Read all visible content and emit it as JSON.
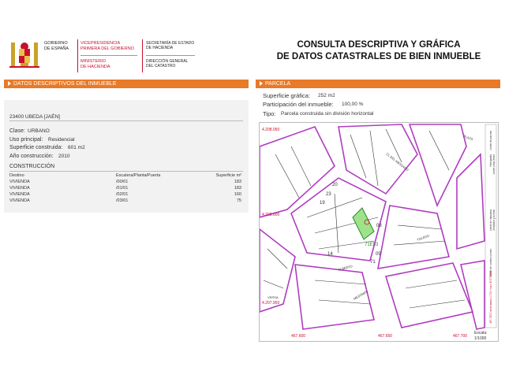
{
  "header": {
    "gov_line1": "GOBIERNO",
    "gov_line2": "DE ESPAÑA",
    "vp_line1": "VICEPRESIDENCIA",
    "vp_line2": "PRIMERA DEL GOBIERNO",
    "min_line1": "MINISTERIO",
    "min_line2": "DE HACIENDA",
    "sec_line1": "SECRETARÍA DE ESTADO",
    "sec_line2": "DE HACIENDA",
    "dir_line1": "DIRECCIÓN GENERAL",
    "dir_line2": "DEL CATASTRO",
    "title_line1": "CONSULTA DESCRIPTIVA Y GRÁFICA",
    "title_line2": "DE DATOS CATASTRALES DE BIEN INMUEBLE",
    "brand_color": "#c8102e",
    "accent_color": "#e87a28"
  },
  "left": {
    "section_title": "DATOS DESCRIPTIVOS DEL INMUEBLE",
    "location": "23400 UBEDA [JAÉN]",
    "clase_label": "Clase:",
    "clase_value": "URBANO",
    "uso_label": "Uso principal:",
    "uso_value": "Residencial",
    "superficie_label": "Superficie construida:",
    "superficie_value": "601 m2",
    "anio_label": "Año construcción:",
    "anio_value": "2010",
    "construccion_title": "CONSTRUCCIÓN",
    "table": {
      "headers": [
        "Destino",
        "Escalera/Planta/Puerta",
        "Superficie m²"
      ],
      "rows": [
        [
          "VIVIENDA",
          "/00/01",
          "183"
        ],
        [
          "VIVIENDA",
          "/01/01",
          "183"
        ],
        [
          "VIVIENDA",
          "/02/01",
          "160"
        ],
        [
          "VIVIENDA",
          "/03/01",
          "75"
        ]
      ]
    }
  },
  "right": {
    "section_title": "PARCELA",
    "sup_grafica_label": "Superficie gráfica:",
    "sup_grafica_value": "252 m2",
    "participacion_label": "Participación del inmueble:",
    "participacion_value": "100,00 %",
    "tipo_label": "Tipo:",
    "tipo_value": "Parcela construida sin división horizontal"
  },
  "map": {
    "coord_labels": [
      "4.208.050",
      "4.208.000",
      "4.207.950",
      "467.600",
      "467.650",
      "467.700"
    ],
    "parcel_numbers": [
      "20",
      "19",
      "23",
      "08",
      "09",
      "14",
      "71"
    ],
    "highlight_label": "71E53",
    "street_labels": [
      "PLAZA",
      "CL DEL ABOGADO",
      "TOLEDO",
      "ALBERTO",
      "MESONES",
      "VERSA"
    ],
    "legend_lines": [
      "Límite de parcela",
      "Hidrografía",
      "Límite zona verde",
      "Límite de manzana",
      "Mobiliario y aceras",
      "Límite de construcciones"
    ],
    "side_text": "467.700 Coordenadas U.T.M. Huso 30 ETRS89",
    "scale_label": "Escala:",
    "scale_value": "1/1000"
  }
}
